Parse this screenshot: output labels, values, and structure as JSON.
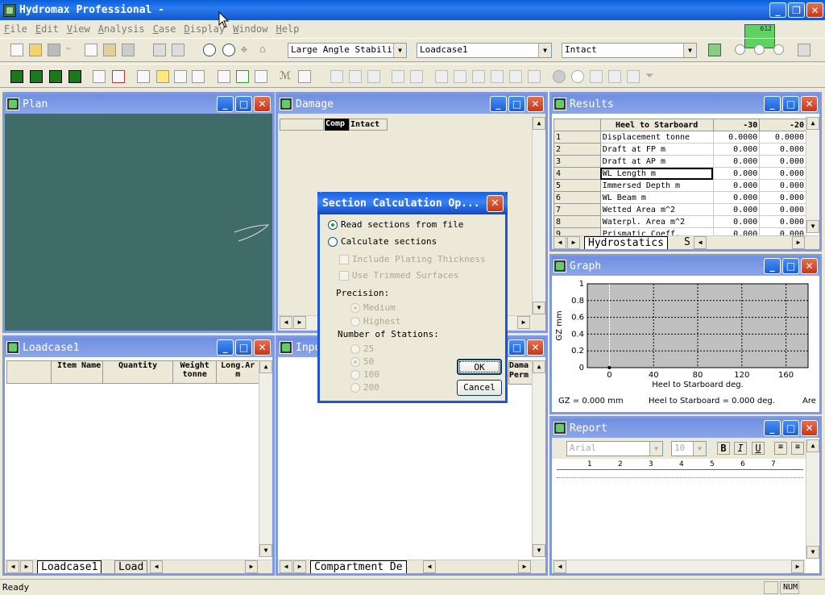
{
  "app": {
    "title": "Hydromax Professional -",
    "status": "Ready",
    "num": "NUM"
  },
  "menu": [
    "File",
    "Edit",
    "View",
    "Analysis",
    "Case",
    "Display",
    "Window",
    "Help"
  ],
  "toolbar": {
    "analysis_type": "Large Angle Stability",
    "loadcase": "Loadcase1",
    "condition": "Intact",
    "counter": "612"
  },
  "plan": {
    "title": "Plan"
  },
  "damage": {
    "title": "Damage",
    "col1": "Comp",
    "col2": "Intact"
  },
  "results": {
    "title": "Results",
    "headers": [
      "Heel to Starboard",
      "-30",
      "-20"
    ],
    "rows": [
      {
        "n": "1",
        "label": "Displacement tonne",
        "a": "0.0000",
        "b": "0.0000"
      },
      {
        "n": "2",
        "label": "Draft at FP m",
        "a": "0.000",
        "b": "0.000"
      },
      {
        "n": "3",
        "label": "Draft at AP m",
        "a": "0.000",
        "b": "0.000"
      },
      {
        "n": "4",
        "label": "WL Length m",
        "a": "0.000",
        "b": "0.000"
      },
      {
        "n": "5",
        "label": "Immersed Depth m",
        "a": "0.000",
        "b": "0.000"
      },
      {
        "n": "6",
        "label": "WL Beam m",
        "a": "0.000",
        "b": "0.000"
      },
      {
        "n": "7",
        "label": "Wetted Area m^2",
        "a": "0.000",
        "b": "0.000"
      },
      {
        "n": "8",
        "label": "Waterpl. Area m^2",
        "a": "0.000",
        "b": "0.000"
      },
      {
        "n": "9",
        "label": "Prismatic Coeff.",
        "a": "0.000",
        "b": "0.000"
      }
    ],
    "tab": "Hydrostatics",
    "tab2": "S"
  },
  "graph": {
    "title": "Graph",
    "readout_gz": "GZ =  0.000 mm",
    "readout_heel": "Heel to Starboard =  0.000  deg.",
    "readout_area": "Are"
  },
  "chart_data": {
    "type": "line",
    "xlabel": "Heel to Starboard  deg.",
    "ylabel": "GZ  mm",
    "xlim": [
      -20,
      180
    ],
    "ylim": [
      0,
      1
    ],
    "xticks": [
      "0",
      "40",
      "80",
      "120",
      "160"
    ],
    "yticks": [
      "0",
      "0.2",
      "0.4",
      "0.6",
      "0.8",
      "1"
    ],
    "x": [
      0
    ],
    "y": [
      0
    ],
    "grid": true
  },
  "loadcase": {
    "title": "Loadcase1",
    "headers": [
      "Item Name",
      "Quantity",
      "Weight tonne",
      "Long.Ar m"
    ],
    "tab1": "Loadcase1",
    "tab2": "Load"
  },
  "input": {
    "title": "Inpu",
    "col1": "Dama Perm",
    "tab": "Compartment De"
  },
  "report": {
    "title": "Report",
    "font": "Arial",
    "size": "10",
    "ruler": [
      "1",
      "2",
      "3",
      "4",
      "5",
      "6",
      "7"
    ]
  },
  "dialog": {
    "title": "Section Calculation Op...",
    "opt_read": "Read sections from file",
    "opt_calc": "Calculate sections",
    "chk_plating": "Include Plating Thickness",
    "chk_trimmed": "Use Trimmed Surfaces",
    "precision_label": "Precision:",
    "prec_medium": "Medium",
    "prec_highest": "Highest",
    "stations_label": "Number of Stations:",
    "st": [
      "25",
      "50",
      "100",
      "200"
    ],
    "ok": "OK",
    "cancel": "Cancel"
  }
}
